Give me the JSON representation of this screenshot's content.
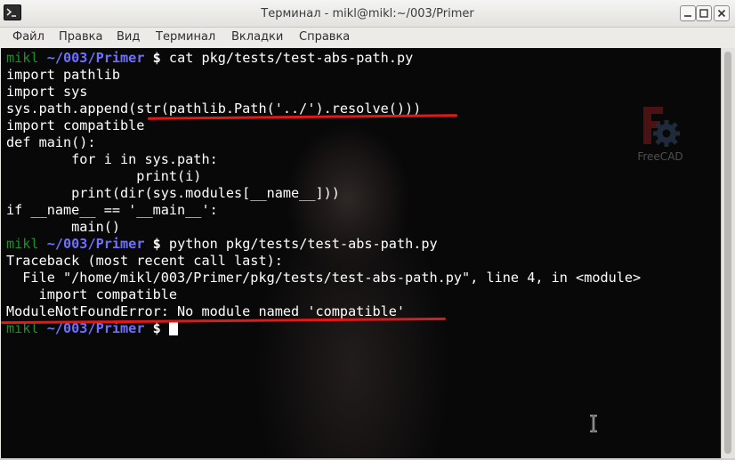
{
  "window": {
    "title": "Терминал - mikl@mikl:~/003/Primer"
  },
  "menubar": {
    "items": [
      "Файл",
      "Правка",
      "Вид",
      "Терминал",
      "Вкладки",
      "Справка"
    ]
  },
  "desktop_icon": {
    "label": "FreeCAD",
    "icon": "freecad-icon"
  },
  "prompt": {
    "user": "mikl",
    "path": "~/003/Primer",
    "symbol": "$"
  },
  "terminal": {
    "commands": [
      " cat pkg/tests/test-abs-path.py",
      " python pkg/tests/test-abs-path.py"
    ],
    "output": [
      "import pathlib",
      "import sys",
      "sys.path.append(str(pathlib.Path('../').resolve()))",
      "import compatible",
      "def main():",
      "        for i in sys.path:",
      "                print(i)",
      "        print(dir(sys.modules[__name__]))",
      "if __name__ == '__main__':",
      "        main()",
      "Traceback (most recent call last):",
      "  File \"/home/mikl/003/Primer/pkg/tests/test-abs-path.py\", line 4, in <module>",
      "    import compatible",
      "ModuleNotFoundError: No module named 'compatible'"
    ]
  },
  "colors": {
    "terminal_bg": "#080808",
    "prompt_user": "#1a8f2a",
    "prompt_path": "#6f70ff",
    "annotation": "#e01919"
  }
}
